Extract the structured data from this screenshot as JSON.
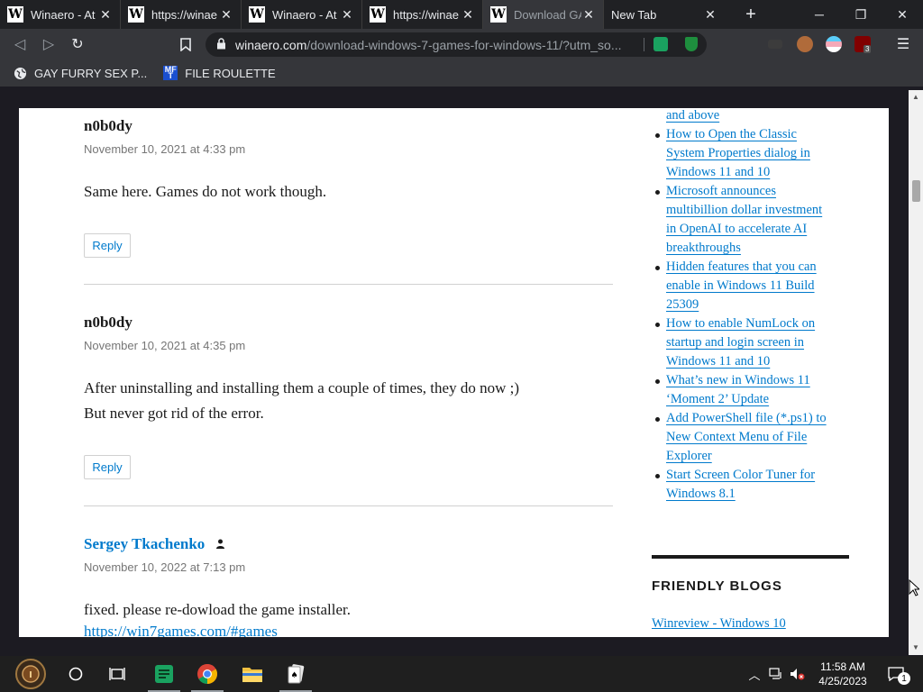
{
  "tabs": [
    {
      "title": "Winaero - At",
      "active": false
    },
    {
      "title": "https://winae",
      "active": false
    },
    {
      "title": "Winaero - At",
      "active": false
    },
    {
      "title": "https://winae",
      "active": false
    },
    {
      "title": "Download GAY",
      "active": true
    },
    {
      "title": "New Tab",
      "active": false
    }
  ],
  "address": {
    "host": "winaero.com",
    "path": "/download-windows-7-games-for-windows-11/?utm_so..."
  },
  "bookmarks": [
    {
      "label": "GAY FURRY SEX P...",
      "icon": "globe-icon"
    },
    {
      "label": "FILE ROULETTE",
      "icon": "mft-icon"
    }
  ],
  "extension_badge": "3",
  "comments": [
    {
      "author": "n0b0dy",
      "date": "November 10, 2021 at 4:33 pm",
      "lines": [
        "Same here. Games do not work though."
      ],
      "reply": "Reply"
    },
    {
      "author": "n0b0dy",
      "date": "November 10, 2021 at 4:35 pm",
      "lines": [
        "After uninstalling and installing them a couple of times, they do now ;)",
        "But never got rid of the error."
      ],
      "reply": "Reply"
    },
    {
      "author": "Sergey Tkachenko",
      "date": "November 10, 2022 at 7:13 pm",
      "lines": [
        "fixed. please re-dowload the game installer.",
        "https://win7games.com/#games"
      ]
    }
  ],
  "sidebar": {
    "items": [
      [
        "and above"
      ],
      [
        "How to Open the Classic",
        "System Properties dialog in",
        "Windows 11 and 10"
      ],
      [
        "Microsoft announces",
        "multibillion dollar investment",
        "in OpenAI to accelerate AI",
        "breakthroughs"
      ],
      [
        "Hidden features that you can",
        "enable in Windows 11 Build",
        "25309"
      ],
      [
        "How to enable NumLock on",
        "startup and login screen in",
        "Windows 11 and 10"
      ],
      [
        "What’s new in Windows 11",
        "‘Moment 2’ Update"
      ],
      [
        "Add PowerShell file (*.ps1) to",
        "New Context Menu of File",
        "Explorer"
      ],
      [
        "Start Screen Color Tuner for",
        "Windows 8.1"
      ]
    ],
    "friendly_heading": "FRIENDLY BLOGS",
    "blog_link": "Winreview - Windows 10"
  },
  "clock": {
    "time": "11:58 AM",
    "date": "4/25/2023"
  },
  "notification_count": "1"
}
